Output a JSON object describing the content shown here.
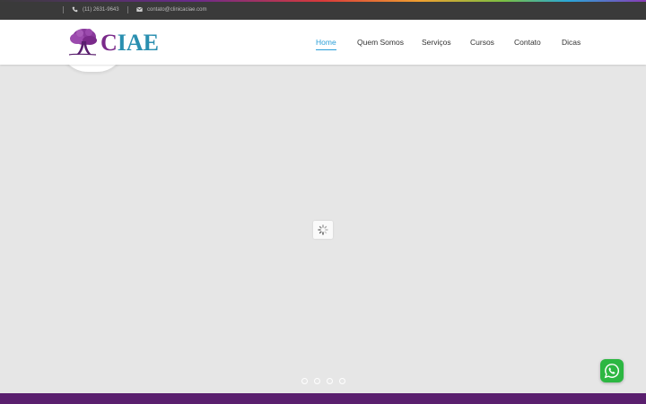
{
  "topbar": {
    "phone": "(11) 2631-9643",
    "email": "contato@clinicaciae.com",
    "phone_icon": "phone-icon",
    "email_icon": "envelope-icon"
  },
  "logo": {
    "text_first": "C",
    "text_rest": "IAE",
    "tree_icon": "tree-icon"
  },
  "nav": {
    "items": [
      {
        "label": "Home",
        "active": true
      },
      {
        "label": "Quem Somos",
        "active": false
      },
      {
        "label": "Serviços",
        "active": false
      },
      {
        "label": "Cursos",
        "active": false
      },
      {
        "label": "Contato",
        "active": false
      },
      {
        "label": "Dicas",
        "active": false
      }
    ]
  },
  "slider": {
    "loader_icon": "spinner-icon",
    "dot_count": 4
  },
  "whatsapp": {
    "icon": "whatsapp-icon"
  },
  "colors": {
    "topbar_bg": "#3a3a3a",
    "nav_active": "#2a9fd8",
    "logo_purple": "#7a2a8a",
    "logo_blue": "#2a8fb0",
    "whatsapp_green": "#2cb742",
    "footer_purple": "#5a1f6e"
  }
}
